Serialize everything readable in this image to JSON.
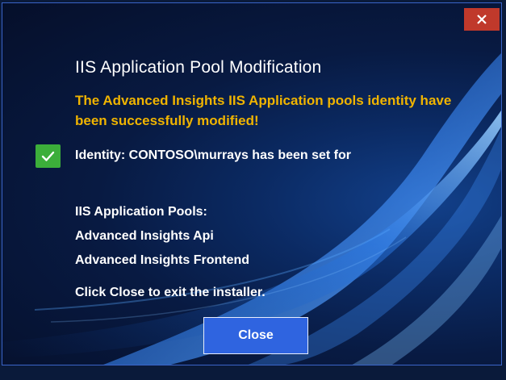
{
  "dialog": {
    "title": "IIS Application Pool Modification",
    "success_message": "The Advanced Insights IIS Application pools identity have been successfully modified!",
    "identity_text": "Identity: CONTOSO\\murrays has been set for",
    "pools_label": "IIS Application Pools:",
    "pools": [
      "Advanced Insights Api",
      "Advanced Insights Frontend"
    ],
    "instruction": "Click Close to exit the installer.",
    "close_button_label": "Close",
    "window_close_icon": "close-icon",
    "status_icon": "checkmark-icon"
  },
  "colors": {
    "accent_button": "#2f64e0",
    "success_text": "#f0b400",
    "check_green": "#3cae3a",
    "window_close": "#c0392b"
  }
}
